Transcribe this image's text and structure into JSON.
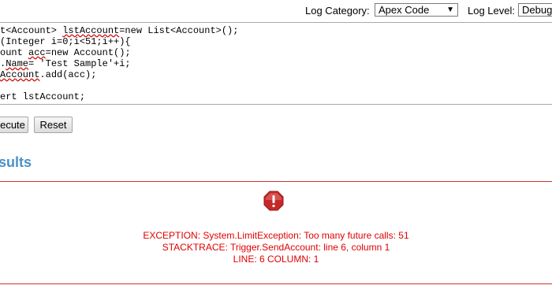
{
  "toolbar": {
    "log_category_label": "Log Category:",
    "log_category_value": "Apex Code",
    "log_level_label": "Log Level:",
    "log_level_value": "Debug"
  },
  "code": {
    "line1": {
      "pre": "t<Account> ",
      "err": "lstAccount",
      "post": "=new List<Account>();"
    },
    "line2": "(Integer i=0;i<51;i++){",
    "line3": {
      "pre": "ount ",
      "err": "acc",
      "post": "=new Account();"
    },
    "line4": {
      "pre": ".",
      "err": "Name",
      "post": "= 'Test Sample'+i;"
    },
    "line5": {
      "pre": "",
      "err": "Account",
      "post": ".add(acc);"
    },
    "line7": "ert lstAccount;"
  },
  "buttons": {
    "execute": "ecute",
    "reset": "Reset"
  },
  "results": {
    "heading": "sults",
    "exception": "EXCEPTION: System.LimitException: Too many future calls: 51",
    "stacktrace": "STACKTRACE: Trigger.SendAccount: line 6, column 1",
    "line": "LINE: 6 COLUMN: 1"
  },
  "colors": {
    "error": "#e00000",
    "heading": "#4a90c8"
  }
}
